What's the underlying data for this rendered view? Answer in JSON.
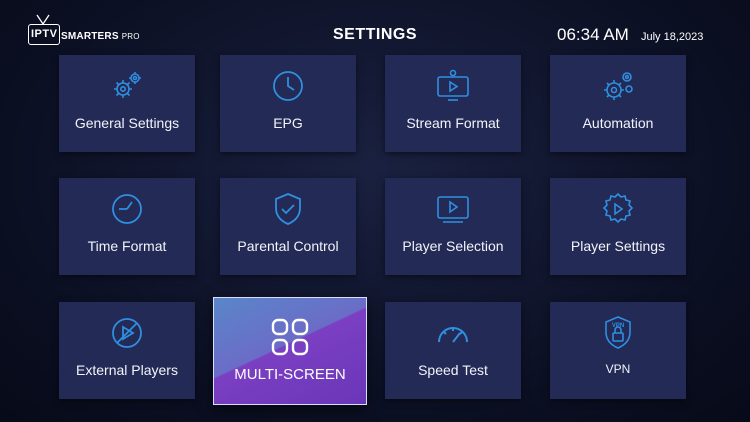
{
  "header": {
    "logo_text": "IPTV SMARTERS PRO",
    "title": "SETTINGS",
    "time": "06:34 AM",
    "date": "July 18,2023"
  },
  "colors": {
    "tile_bg": "#232a55",
    "icon_blue": "#2f8fe0",
    "selected_from": "#5a86c9",
    "selected_to": "#7b3fc2"
  },
  "tiles": [
    {
      "label": "General Settings",
      "icon": "gears-icon"
    },
    {
      "label": "EPG",
      "icon": "clock-icon"
    },
    {
      "label": "Stream Format",
      "icon": "tv-play-icon"
    },
    {
      "label": "Automation",
      "icon": "gear-automation-icon"
    },
    {
      "label": "Time Format",
      "icon": "clock-icon"
    },
    {
      "label": "Parental Control",
      "icon": "shield-check-icon"
    },
    {
      "label": "Player Selection",
      "icon": "screen-play-icon"
    },
    {
      "label": "Player Settings",
      "icon": "gear-play-icon"
    },
    {
      "label": "External Players",
      "icon": "external-player-icon"
    },
    {
      "label": "MULTI-SCREEN",
      "icon": "grid-four-icon",
      "selected": true
    },
    {
      "label": "Speed Test",
      "icon": "speedometer-icon"
    },
    {
      "label": "VPN",
      "icon": "vpn-shield-icon"
    }
  ]
}
